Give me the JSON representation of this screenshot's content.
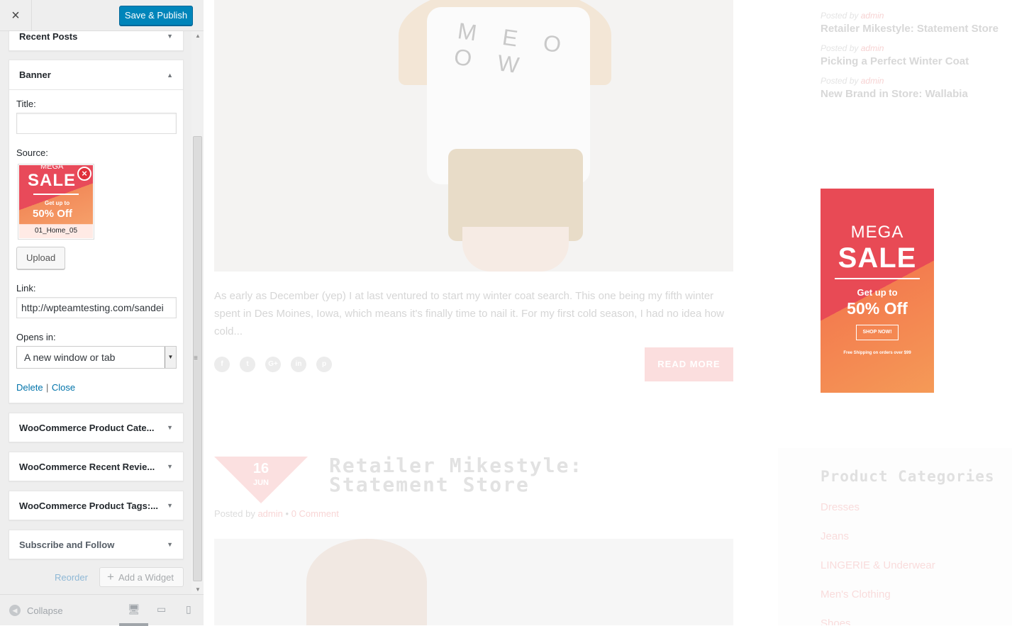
{
  "topbar": {
    "close_icon": "×",
    "publish_label": "Save & Publish"
  },
  "widgets": {
    "recent_posts": "Recent Posts",
    "banner": {
      "title": "Banner",
      "title_label": "Title:",
      "title_value": "",
      "source_label": "Source:",
      "thumb": {
        "mega": "MEGA",
        "sale": "SALE",
        "get": "Get up to",
        "off": "50% Off",
        "filename": "01_Home_05"
      },
      "upload_label": "Upload",
      "link_label": "Link:",
      "link_value": "http://wpteamtesting.com/sandei",
      "opens_label": "Opens in:",
      "opens_value": "A new window or tab",
      "delete_label": "Delete",
      "separator": "|",
      "close_label": "Close"
    },
    "woo_categories": "WooCommerce Product Cate...",
    "woo_reviews": "WooCommerce Recent Revie...",
    "woo_tags": "WooCommerce Product Tags:...",
    "subscribe": "Subscribe and Follow"
  },
  "actions": {
    "reorder": "Reorder",
    "add_widget": "Add a Widget"
  },
  "footer": {
    "collapse": "Collapse"
  },
  "preview": {
    "hero_text": "M E O O W",
    "excerpt": "As early as December (yep) I at last ventured to start my winter coat search. This one being my fifth winter spent in Des Moines, Iowa, which means it's finally time to nail it. For my first cold season, I had no idea how cold...",
    "read_more": "READ MORE",
    "socials": [
      "f",
      "t",
      "G+",
      "in",
      "p"
    ],
    "post2": {
      "day": "16",
      "month": "JUN",
      "title": "Retailer Mikestyle: Statement Store",
      "meta_prefix": "Posted by",
      "author": "admin",
      "bullet": "•",
      "comments": "0 Comment"
    },
    "sidebar_posts": [
      {
        "meta": "Posted by",
        "author": "admin",
        "title": "Retailer Mikestyle: Statement Store"
      },
      {
        "meta": "Posted by",
        "author": "admin",
        "title": "Picking a Perfect Winter Coat"
      },
      {
        "meta": "Posted by",
        "author": "admin",
        "title": "New Brand in Store: Wallabia"
      }
    ],
    "promo": {
      "mega": "MEGA",
      "sale": "SALE",
      "get": "Get up to",
      "off": "50% Off",
      "shop": "SHOP NOW!",
      "shipping": "Free Shipping on orders over $99"
    },
    "product_categories": {
      "title": "Product Categories",
      "items": [
        "Dresses",
        "Jeans",
        "LINGERIE & Underwear",
        "Men's Clothing",
        "Shoes"
      ]
    }
  },
  "colors": {
    "primary": "#0085ba",
    "accent_pink": "#e84a55",
    "accent_orange": "#f59a57"
  }
}
